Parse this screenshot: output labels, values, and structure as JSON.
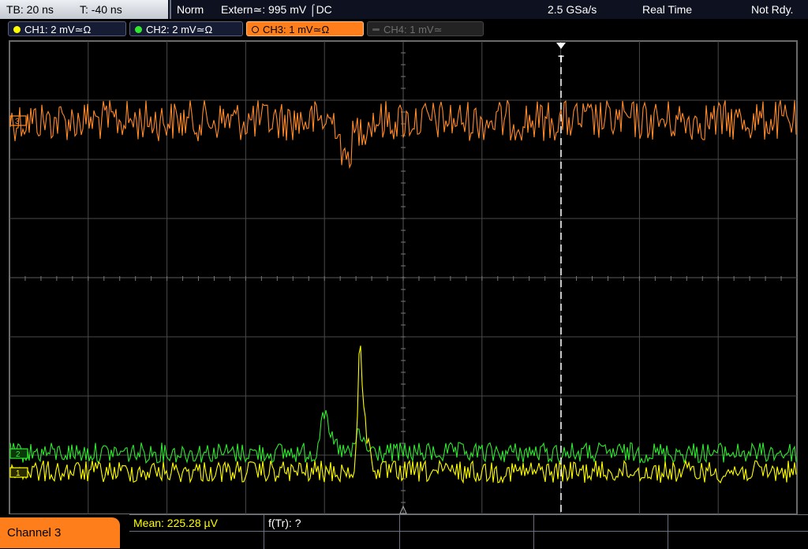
{
  "status": {
    "timebase": "TB: 20 ns",
    "trigger_time": "T: -40 ns",
    "acq_mode": "Norm",
    "trigger_source": "Extern≃: 995 mV ⌠DC",
    "sample_rate": "2.5 GSa/s",
    "mode": "Real Time",
    "state": "Not Rdy."
  },
  "channels": [
    {
      "id": "ch1",
      "label": "CH1: 2 mV≃Ω",
      "color": "#ffff00"
    },
    {
      "id": "ch2",
      "label": "CH2: 2 mV≃Ω",
      "color": "#2fe82f"
    },
    {
      "id": "ch3",
      "label": "CH3: 1 mV≃Ω",
      "color": "#ff8a2a"
    },
    {
      "id": "ch4",
      "label": "CH4: 1 mV≃",
      "color": "#5a5a5a"
    }
  ],
  "markers": {
    "trigger": "T",
    "ch3": "3",
    "ch2": "2",
    "ch1": "1"
  },
  "bottom": {
    "channel_button": "Channel 3",
    "mean": "Mean: 225.28 µV",
    "ftr": "f(Tr): ?"
  },
  "colors": {
    "ch1": "#ffff00",
    "ch2": "#2fe82f",
    "ch3": "#ff8a2a",
    "grid": "#4a4a4a",
    "accent": "#ff7e1c"
  }
}
